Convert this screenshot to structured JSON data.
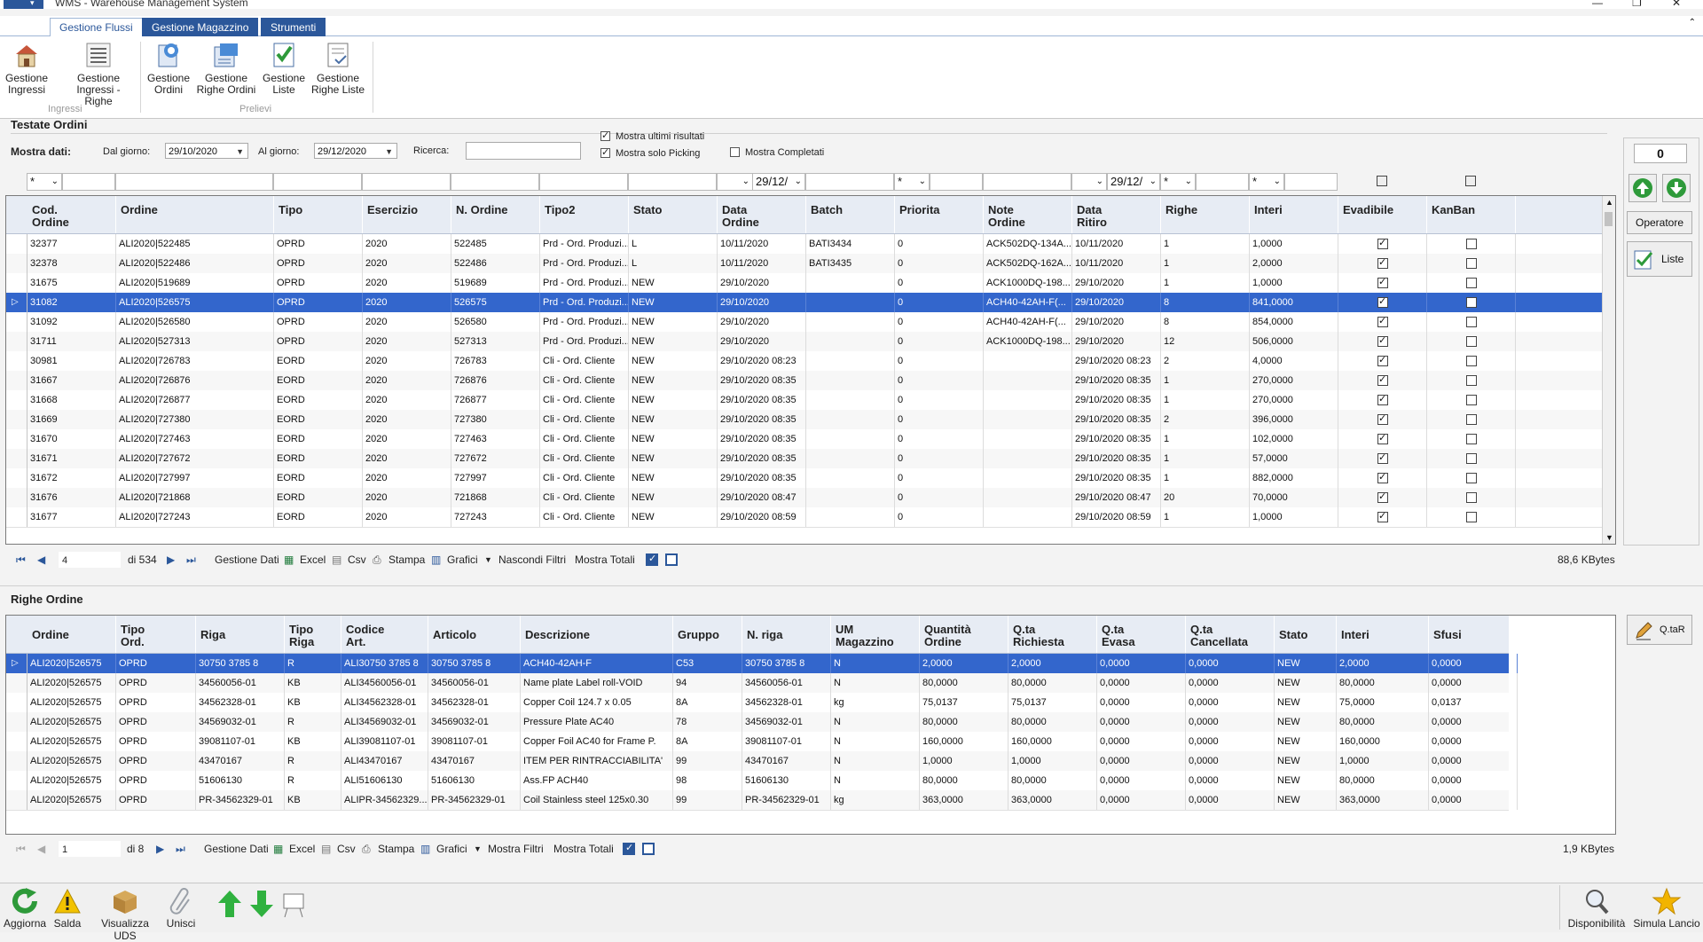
{
  "window": {
    "title": "WMS - Warehouse Management System"
  },
  "ribbon": {
    "tabs": [
      {
        "label": "Gestione Flussi",
        "active": true
      },
      {
        "label": "Gestione Magazzino",
        "active": false
      },
      {
        "label": "Strumenti",
        "active": false
      }
    ],
    "groups": {
      "ingressi": {
        "label": "Ingressi",
        "buttons": [
          {
            "label": "Gestione\nIngressi",
            "icon": "warehouse-icon"
          },
          {
            "label": "Gestione\nIngressi - Righe",
            "icon": "list-icon"
          }
        ]
      },
      "prelievi": {
        "label": "Prelievi",
        "buttons": [
          {
            "label": "Gestione\nOrdini",
            "icon": "orders-icon"
          },
          {
            "label": "Gestione\nRighe Ordini",
            "icon": "order-rows-icon"
          },
          {
            "label": "Gestione\nListe",
            "icon": "checklist-icon"
          },
          {
            "label": "Gestione\nRighe Liste",
            "icon": "checklist-rows-icon"
          }
        ]
      }
    }
  },
  "testate": {
    "title": "Testate Ordini",
    "filters": {
      "mostra_dati": "Mostra dati:",
      "dal_giorno_label": "Dal giorno:",
      "dal_giorno": "29/10/2020",
      "al_giorno_label": "Al giorno:",
      "al_giorno": "29/12/2020",
      "ricerca_label": "Ricerca:",
      "ricerca_value": "",
      "mostra_ultimi": "Mostra ultimi risultati",
      "mostra_solo_picking": "Mostra solo Picking",
      "mostra_completati": "Mostra Completati",
      "mostra_ultimi_checked": true,
      "mostra_solo_picking_checked": true,
      "mostra_completati_checked": false
    },
    "filter_row": {
      "first": "*",
      "data_ordine": "29/12/",
      "priorita": "*",
      "data_ritiro": "29/12/",
      "righe": "*",
      "interi": "*"
    },
    "columns": [
      "Cod.\nOrdine",
      "Ordine",
      "Tipo",
      "Esercizio",
      "N. Ordine",
      "Tipo2",
      "Stato",
      "Data\nOrdine",
      "Batch",
      "Priorita",
      "Note\nOrdine",
      "Data\nRitiro",
      "Righe",
      "Interi",
      "Evadibile",
      "KanBan"
    ],
    "rows": [
      [
        "32377",
        "ALI2020|522485",
        "OPRD",
        "2020",
        "522485",
        "Prd - Ord. Produzi...",
        "L",
        "10/11/2020",
        "BATI3434",
        "0",
        "ACK502DQ-134A...",
        "10/11/2020",
        "1",
        "1,0000",
        true,
        false
      ],
      [
        "32378",
        "ALI2020|522486",
        "OPRD",
        "2020",
        "522486",
        "Prd - Ord. Produzi...",
        "L",
        "10/11/2020",
        "BATI3435",
        "0",
        "ACK502DQ-162A...",
        "10/11/2020",
        "1",
        "2,0000",
        true,
        false
      ],
      [
        "31675",
        "ALI2020|519689",
        "OPRD",
        "2020",
        "519689",
        "Prd - Ord. Produzi...",
        "NEW",
        "29/10/2020",
        "",
        "0",
        "ACK1000DQ-198...",
        "29/10/2020",
        "1",
        "1,0000",
        true,
        false
      ],
      [
        "31082",
        "ALI2020|526575",
        "OPRD",
        "2020",
        "526575",
        "Prd - Ord. Produzi...",
        "NEW",
        "29/10/2020",
        "",
        "0",
        "ACH40-42AH-F(...",
        "29/10/2020",
        "8",
        "841,0000",
        true,
        false
      ],
      [
        "31092",
        "ALI2020|526580",
        "OPRD",
        "2020",
        "526580",
        "Prd - Ord. Produzi...",
        "NEW",
        "29/10/2020",
        "",
        "0",
        "ACH40-42AH-F(...",
        "29/10/2020",
        "8",
        "854,0000",
        true,
        false
      ],
      [
        "31711",
        "ALI2020|527313",
        "OPRD",
        "2020",
        "527313",
        "Prd - Ord. Produzi...",
        "NEW",
        "29/10/2020",
        "",
        "0",
        "ACK1000DQ-198...",
        "29/10/2020",
        "12",
        "506,0000",
        true,
        false
      ],
      [
        "30981",
        "ALI2020|726783",
        "EORD",
        "2020",
        "726783",
        "Cli - Ord. Cliente",
        "NEW",
        "29/10/2020 08:23",
        "",
        "0",
        "",
        "29/10/2020 08:23",
        "2",
        "4,0000",
        true,
        false
      ],
      [
        "31667",
        "ALI2020|726876",
        "EORD",
        "2020",
        "726876",
        "Cli - Ord. Cliente",
        "NEW",
        "29/10/2020 08:35",
        "",
        "0",
        "",
        "29/10/2020 08:35",
        "1",
        "270,0000",
        true,
        false
      ],
      [
        "31668",
        "ALI2020|726877",
        "EORD",
        "2020",
        "726877",
        "Cli - Ord. Cliente",
        "NEW",
        "29/10/2020 08:35",
        "",
        "0",
        "",
        "29/10/2020 08:35",
        "1",
        "270,0000",
        true,
        false
      ],
      [
        "31669",
        "ALI2020|727380",
        "EORD",
        "2020",
        "727380",
        "Cli - Ord. Cliente",
        "NEW",
        "29/10/2020 08:35",
        "",
        "0",
        "",
        "29/10/2020 08:35",
        "2",
        "396,0000",
        true,
        false
      ],
      [
        "31670",
        "ALI2020|727463",
        "EORD",
        "2020",
        "727463",
        "Cli - Ord. Cliente",
        "NEW",
        "29/10/2020 08:35",
        "",
        "0",
        "",
        "29/10/2020 08:35",
        "1",
        "102,0000",
        true,
        false
      ],
      [
        "31671",
        "ALI2020|727672",
        "EORD",
        "2020",
        "727672",
        "Cli - Ord. Cliente",
        "NEW",
        "29/10/2020 08:35",
        "",
        "0",
        "",
        "29/10/2020 08:35",
        "1",
        "57,0000",
        true,
        false
      ],
      [
        "31672",
        "ALI2020|727997",
        "EORD",
        "2020",
        "727997",
        "Cli - Ord. Cliente",
        "NEW",
        "29/10/2020 08:35",
        "",
        "0",
        "",
        "29/10/2020 08:35",
        "1",
        "882,0000",
        true,
        false
      ],
      [
        "31676",
        "ALI2020|721868",
        "EORD",
        "2020",
        "721868",
        "Cli - Ord. Cliente",
        "NEW",
        "29/10/2020 08:47",
        "",
        "0",
        "",
        "29/10/2020 08:47",
        "20",
        "70,0000",
        true,
        false
      ],
      [
        "31677",
        "ALI2020|727243",
        "EORD",
        "2020",
        "727243",
        "Cli - Ord. Cliente",
        "NEW",
        "29/10/2020 08:59",
        "",
        "0",
        "",
        "29/10/2020 08:59",
        "1",
        "1,0000",
        true,
        false
      ]
    ],
    "selected_row": 3,
    "nav": {
      "page": "4",
      "of": "di 534",
      "gestione_dati": "Gestione Dati",
      "excel": "Excel",
      "csv": "Csv",
      "stampa": "Stampa",
      "grafici": "Grafici",
      "filtri": "Nascondi Filtri",
      "totali": "Mostra Totali",
      "size": "88,6 KBytes"
    }
  },
  "side": {
    "counter": "0",
    "operatore": "Operatore",
    "liste": "Liste",
    "qtar": "Q.taR"
  },
  "righe": {
    "title": "Righe Ordine",
    "columns": [
      "Ordine",
      "Tipo\nOrd.",
      "Riga",
      "Tipo\nRiga",
      "Codice\nArt.",
      "Articolo",
      "Descrizione",
      "Gruppo",
      "N. riga",
      "UM\nMagazzino",
      "Quantità\nOrdine",
      "Q.ta\nRichiesta",
      "Q.ta\nEvasa",
      "Q.ta\nCancellata",
      "Stato",
      "Interi",
      "Sfusi"
    ],
    "rows": [
      [
        "ALI2020|526575",
        "OPRD",
        "30750 3785 8",
        "R",
        "ALI30750 3785 8",
        "30750 3785 8",
        "ACH40-42AH-F",
        "C53",
        "30750 3785 8",
        "N",
        "2,0000",
        "2,0000",
        "0,0000",
        "0,0000",
        "NEW",
        "2,0000",
        "0,0000"
      ],
      [
        "ALI2020|526575",
        "OPRD",
        "34560056-01",
        "KB",
        "ALI34560056-01",
        "34560056-01",
        "Name plate Label roll-VOID",
        "94",
        "34560056-01",
        "N",
        "80,0000",
        "80,0000",
        "0,0000",
        "0,0000",
        "NEW",
        "80,0000",
        "0,0000"
      ],
      [
        "ALI2020|526575",
        "OPRD",
        "34562328-01",
        "KB",
        "ALI34562328-01",
        "34562328-01",
        "Copper Coil 124.7 x 0.05",
        "8A",
        "34562328-01",
        "kg",
        "75,0137",
        "75,0137",
        "0,0000",
        "0,0000",
        "NEW",
        "75,0000",
        "0,0137"
      ],
      [
        "ALI2020|526575",
        "OPRD",
        "34569032-01",
        "R",
        "ALI34569032-01",
        "34569032-01",
        "Pressure Plate   AC40",
        "78",
        "34569032-01",
        "N",
        "80,0000",
        "80,0000",
        "0,0000",
        "0,0000",
        "NEW",
        "80,0000",
        "0,0000"
      ],
      [
        "ALI2020|526575",
        "OPRD",
        "39081107-01",
        "KB",
        "ALI39081107-01",
        "39081107-01",
        "Copper Foil AC40 for Frame P.",
        "8A",
        "39081107-01",
        "N",
        "160,0000",
        "160,0000",
        "0,0000",
        "0,0000",
        "NEW",
        "160,0000",
        "0,0000"
      ],
      [
        "ALI2020|526575",
        "OPRD",
        "43470167",
        "R",
        "ALI43470167",
        "43470167",
        "ITEM PER RINTRACCIABILITA'",
        "99",
        "43470167",
        "N",
        "1,0000",
        "1,0000",
        "0,0000",
        "0,0000",
        "NEW",
        "1,0000",
        "0,0000"
      ],
      [
        "ALI2020|526575",
        "OPRD",
        "51606130",
        "R",
        "ALI51606130",
        "51606130",
        "Ass.FP ACH40",
        "98",
        "51606130",
        "N",
        "80,0000",
        "80,0000",
        "0,0000",
        "0,0000",
        "NEW",
        "80,0000",
        "0,0000"
      ],
      [
        "ALI2020|526575",
        "OPRD",
        "PR-34562329-01",
        "KB",
        "ALIPR-34562329...",
        "PR-34562329-01",
        "Coil Stainless steel 125x0.30",
        "99",
        "PR-34562329-01",
        "kg",
        "363,0000",
        "363,0000",
        "0,0000",
        "0,0000",
        "NEW",
        "363,0000",
        "0,0000"
      ]
    ],
    "selected_row": 0,
    "nav": {
      "page": "1",
      "of": "di 8",
      "gestione_dati": "Gestione Dati",
      "excel": "Excel",
      "csv": "Csv",
      "stampa": "Stampa",
      "grafici": "Grafici",
      "filtri": "Mostra Filtri",
      "totali": "Mostra Totali",
      "size": "1,9 KBytes"
    }
  },
  "bottom": {
    "aggiorna": "Aggiorna",
    "salda": "Salda",
    "visualizza_uds": "Visualizza UDS",
    "unisci": "Unisci",
    "disponibilita": "Disponibilità",
    "simula_lancio": "Simula Lancio"
  },
  "colors": {
    "accent": "#2b579a",
    "selection": "#3366cc",
    "header": "#e7ecf4"
  }
}
